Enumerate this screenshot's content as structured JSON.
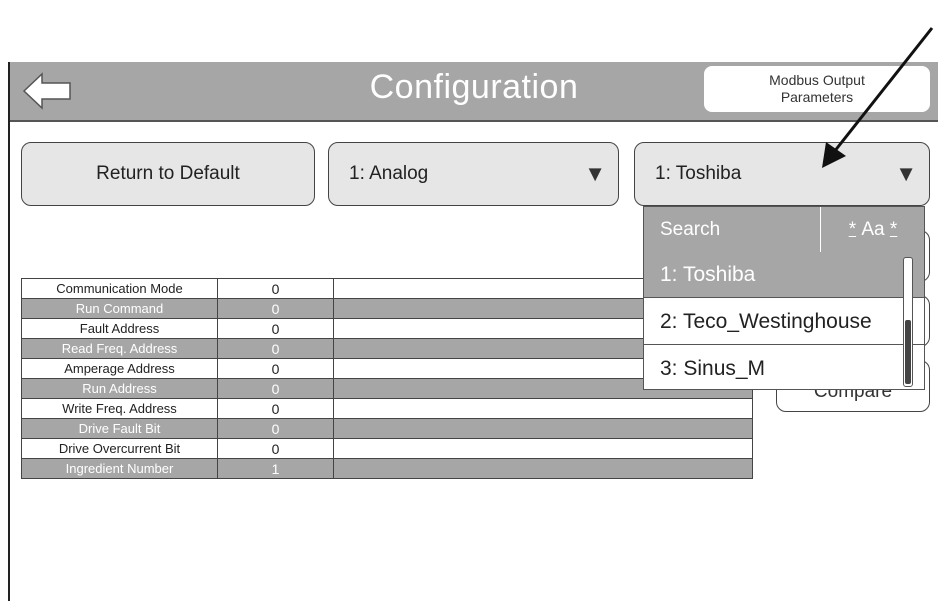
{
  "titlebar": {
    "title": "Configuration",
    "modbus_button_label": "Modbus Output\nParameters"
  },
  "toolbar": {
    "return_label": "Return to Default",
    "select1_value": "1: Analog",
    "select2_value": "1: Toshiba",
    "caret_glyph": "▼",
    "compare_label": "Compare"
  },
  "dropdown": {
    "search_label": "Search",
    "case_toggle_label": "Aa",
    "case_toggle_marks": "*",
    "items": [
      {
        "label": "1: Toshiba",
        "selected": true
      },
      {
        "label": "2: Teco_Westinghouse",
        "selected": false
      },
      {
        "label": "3: Sinus_M",
        "selected": false
      }
    ]
  },
  "params": {
    "rows": [
      {
        "label": "Communication Mode",
        "value": "0"
      },
      {
        "label": "Run Command",
        "value": "0"
      },
      {
        "label": "Fault Address",
        "value": "0"
      },
      {
        "label": "Read Freq. Address",
        "value": "0"
      },
      {
        "label": "Amperage Address",
        "value": "0"
      },
      {
        "label": "Run Address",
        "value": "0"
      },
      {
        "label": "Write Freq. Address",
        "value": "0"
      },
      {
        "label": "Drive Fault Bit",
        "value": "0"
      },
      {
        "label": "Drive Overcurrent Bit",
        "value": "0"
      },
      {
        "label": "Ingredient Number",
        "value": "1"
      }
    ]
  },
  "colors": {
    "titlebar_bg": "#a6a6a6",
    "alt_row_bg": "#a6a6a6",
    "button_bg": "#e6e6e6"
  }
}
